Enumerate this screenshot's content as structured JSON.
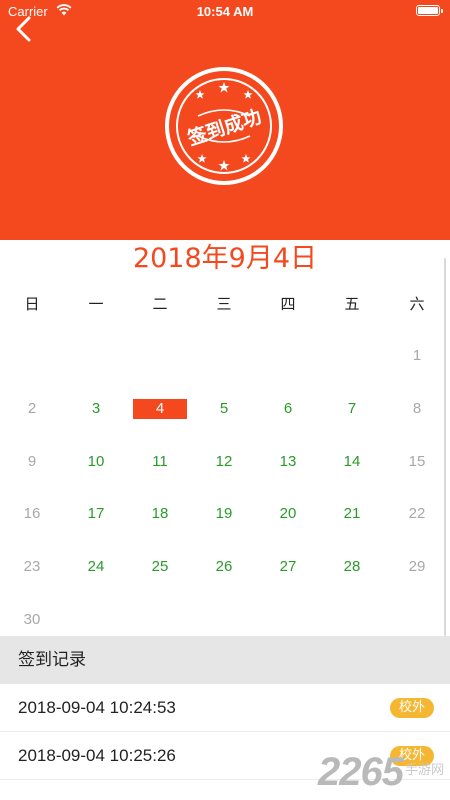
{
  "status_bar": {
    "carrier": "Carrier",
    "time": "10:54 AM"
  },
  "header": {
    "stamp_text": "签到成功",
    "accent_color": "#f4491e"
  },
  "calendar": {
    "title": "2018年9月4日",
    "weekdays": [
      "日",
      "一",
      "二",
      "三",
      "四",
      "五",
      "六"
    ],
    "weeks": [
      [
        null,
        null,
        null,
        null,
        null,
        null,
        {
          "day": "1",
          "state": "muted"
        }
      ],
      [
        {
          "day": "2",
          "state": "muted"
        },
        {
          "day": "3",
          "state": "active"
        },
        {
          "day": "4",
          "state": "selected"
        },
        {
          "day": "5",
          "state": "active"
        },
        {
          "day": "6",
          "state": "active"
        },
        {
          "day": "7",
          "state": "active"
        },
        {
          "day": "8",
          "state": "muted"
        }
      ],
      [
        {
          "day": "9",
          "state": "muted"
        },
        {
          "day": "10",
          "state": "active"
        },
        {
          "day": "11",
          "state": "active"
        },
        {
          "day": "12",
          "state": "active"
        },
        {
          "day": "13",
          "state": "active"
        },
        {
          "day": "14",
          "state": "active"
        },
        {
          "day": "15",
          "state": "muted"
        }
      ],
      [
        {
          "day": "16",
          "state": "muted"
        },
        {
          "day": "17",
          "state": "active"
        },
        {
          "day": "18",
          "state": "active"
        },
        {
          "day": "19",
          "state": "active"
        },
        {
          "day": "20",
          "state": "active"
        },
        {
          "day": "21",
          "state": "active"
        },
        {
          "day": "22",
          "state": "muted"
        }
      ],
      [
        {
          "day": "23",
          "state": "muted"
        },
        {
          "day": "24",
          "state": "active"
        },
        {
          "day": "25",
          "state": "active"
        },
        {
          "day": "26",
          "state": "active"
        },
        {
          "day": "27",
          "state": "active"
        },
        {
          "day": "28",
          "state": "active"
        },
        {
          "day": "29",
          "state": "muted"
        }
      ],
      [
        {
          "day": "30",
          "state": "muted"
        },
        null,
        null,
        null,
        null,
        null,
        null
      ]
    ],
    "colors": {
      "active": "#2a9a2a",
      "muted": "#a8a8a8",
      "selected": "#f4491e"
    }
  },
  "records": {
    "title": "签到记录",
    "items": [
      {
        "time": "2018-09-04 10:24:53",
        "badge": "校外"
      },
      {
        "time": "2018-09-04 10:25:26",
        "badge": "校外"
      }
    ],
    "badge_color": "#f5b731"
  },
  "watermark": {
    "text": "2265",
    "sub": "手游网"
  }
}
